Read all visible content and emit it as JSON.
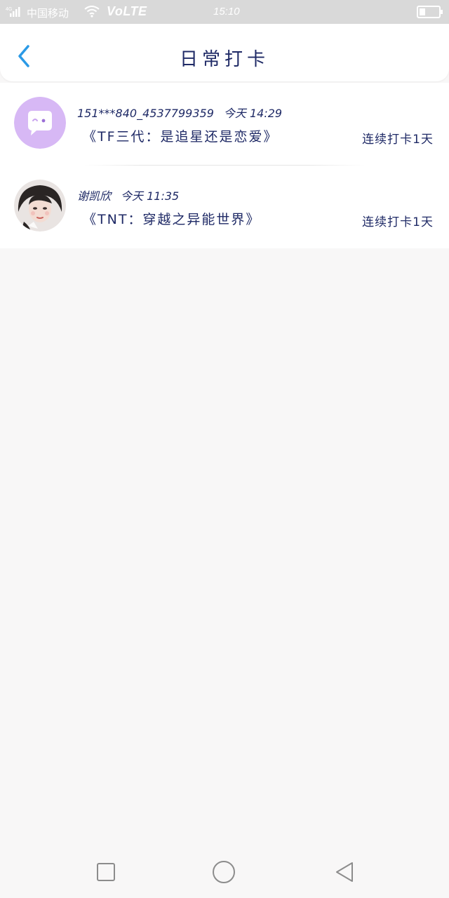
{
  "status_bar": {
    "network": "4G",
    "carrier": "中国移动",
    "volte": "VoLTE",
    "time": "15:10"
  },
  "header": {
    "title": "日常打卡",
    "back_icon": "chevron-left-icon",
    "accent_color": "#2b9ae6"
  },
  "checkins": [
    {
      "user": "151***840_4537799359",
      "time": "今天 14:29",
      "book": "《TF三代：是追星还是恋爱》",
      "streak": "连续打卡1天",
      "avatar": "chat-bubble-avatar",
      "avatar_color": "#d7b8f5"
    },
    {
      "user": "谢凯欣",
      "time": "今天 11:35",
      "book": "《TNT：穿越之异能世界》",
      "streak": "连续打卡1天",
      "avatar": "portrait-avatar"
    }
  ],
  "nav": {
    "recents_icon": "square-icon",
    "home_icon": "circle-icon",
    "back_icon": "triangle-back-icon"
  }
}
